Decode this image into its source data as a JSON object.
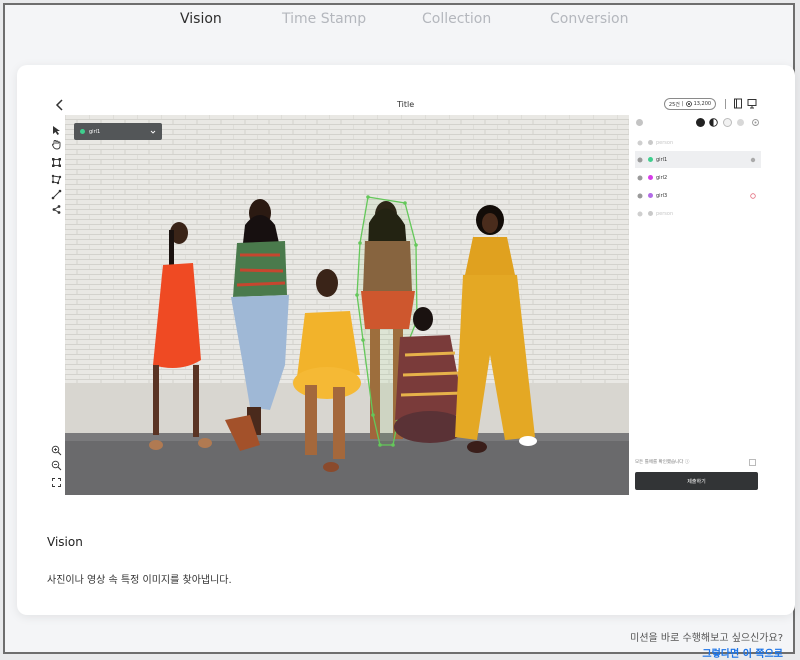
{
  "tabs": [
    {
      "label": "Vision",
      "active": true
    },
    {
      "label": "Time Stamp",
      "active": false
    },
    {
      "label": "Collection",
      "active": false
    },
    {
      "label": "Conversion",
      "active": false
    }
  ],
  "editor": {
    "title": "Title",
    "credit": {
      "left": "25건",
      "divider": "|",
      "amount": "13,200"
    },
    "selected_object": "girl1",
    "objects": [
      {
        "label": "person",
        "color": "#c9c9c9",
        "muted": true
      },
      {
        "label": "girl1",
        "color": "#3fcf8e",
        "muted": false,
        "highlight": true
      },
      {
        "label": "girl2",
        "color": "#d63de8",
        "muted": false
      },
      {
        "label": "girl3",
        "color": "#b26be6",
        "muted": false
      },
      {
        "label": "person",
        "color": "#c9c9c9",
        "muted": true
      }
    ],
    "checkbox_label": "모든 틀에를 확인했습니다 ⓘ",
    "submit_label": "제출하기"
  },
  "section": {
    "title": "Vision",
    "description": "사진이나 영상 속 특정 이미지를 찾아냅니다."
  },
  "cta": {
    "question": "미션을 바로 수행해보고 싶으신가요?",
    "link": "그렇다면 이 쪽으로"
  },
  "colors": {
    "accent": "#3fcf8e",
    "link": "#1a73e8",
    "submit": "#323436"
  }
}
